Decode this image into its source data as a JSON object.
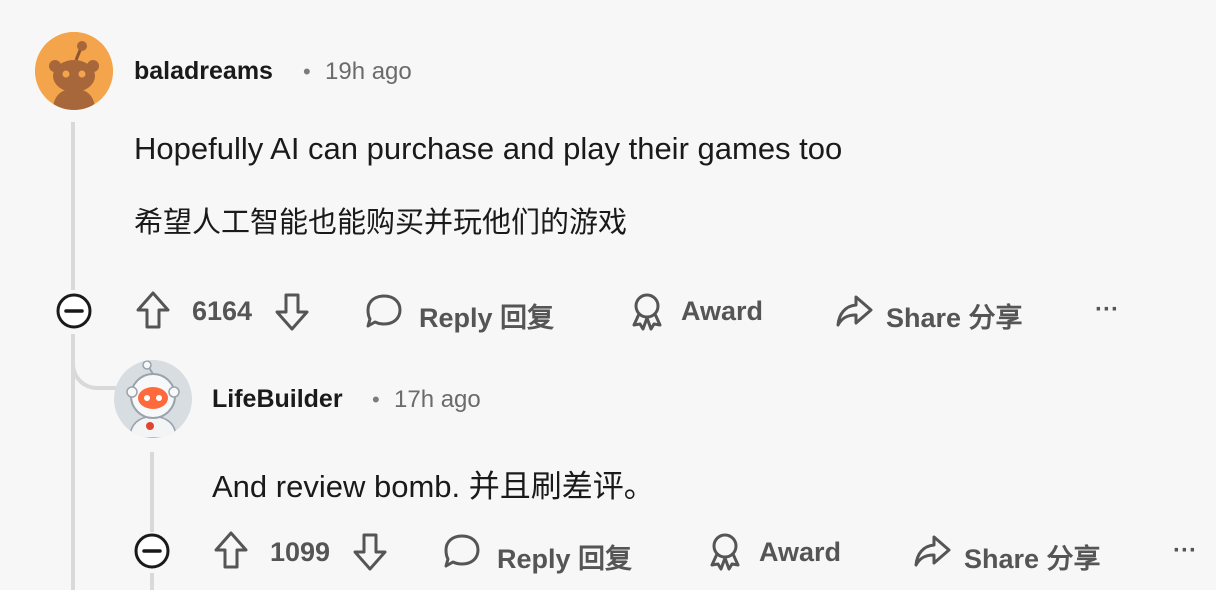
{
  "comments": [
    {
      "username": "baladreams",
      "separator": "•",
      "time": "19h ago",
      "lines": [
        "Hopefully AI can purchase and play their games too",
        "希望人工智能也能购买并玩他们的游戏"
      ],
      "votes": "6164",
      "reply_label": "Reply 回复",
      "award_label": "Award",
      "share_label": "Share 分享",
      "more_label": "···",
      "avatar_color": "#f4a44a"
    },
    {
      "username": "LifeBuilder",
      "separator": "•",
      "time": "17h ago",
      "lines": [
        "And review bomb. 并且刷差评。"
      ],
      "votes": "1099",
      "reply_label": "Reply 回复",
      "award_label": "Award",
      "share_label": "Share 分享",
      "more_label": "···",
      "avatar_color": "#e6e9ec"
    }
  ],
  "colors": {
    "background": "#f7f7f7",
    "thread_line": "#d9d9d9",
    "action_gray": "#555555"
  }
}
